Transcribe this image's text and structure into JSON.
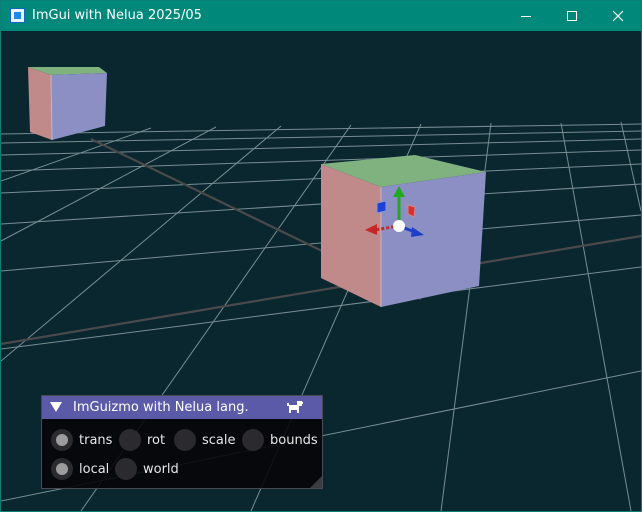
{
  "window": {
    "title": "ImGui with Nelua 2025/05",
    "icons": [
      "app-icon",
      "minimize-icon",
      "maximize-icon",
      "close-icon"
    ]
  },
  "panel": {
    "title": "ImGuizmo with Nelua lang.",
    "title_icon": "dog-icon",
    "operation": {
      "options": [
        "trans",
        "rot",
        "scale",
        "bounds"
      ],
      "selected": "trans"
    },
    "mode": {
      "options": [
        "local",
        "world"
      ],
      "selected": "local"
    }
  },
  "scene": {
    "background_color": "#0a2730",
    "grid_color": "#8a9ea4",
    "cube_colors": {
      "top": "#7fb27f",
      "left": "#c0898a",
      "right": "#8b8fc4"
    },
    "gizmo_colors": {
      "x": "#c62828",
      "y": "#1faa1f",
      "z": "#1e3fc8",
      "center": "#ffffff"
    }
  }
}
